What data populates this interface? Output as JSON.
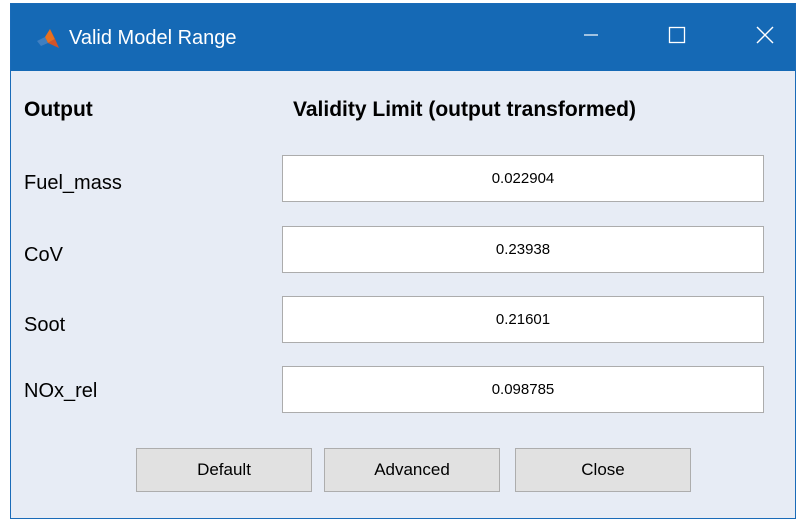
{
  "window": {
    "title": "Valid Model Range",
    "app_icon": "matlab-icon",
    "controls": {
      "minimize_icon": "minimize-icon",
      "maximize_icon": "maximize-icon",
      "close_icon": "close-icon"
    }
  },
  "headers": {
    "output": "Output",
    "validity_limit": "Validity Limit (output transformed)"
  },
  "rows": [
    {
      "label": "Fuel_mass",
      "value": "0.022904"
    },
    {
      "label": "CoV",
      "value": "0.23938"
    },
    {
      "label": "Soot",
      "value": "0.21601"
    },
    {
      "label": "NOx_rel",
      "value": "0.098785"
    }
  ],
  "buttons": {
    "default_label": "Default",
    "advanced_label": "Advanced",
    "close_label": "Close"
  },
  "colors": {
    "titlebar": "#1569b5",
    "window_background": "#e7ecf5",
    "button_face": "#e1e1e1"
  }
}
